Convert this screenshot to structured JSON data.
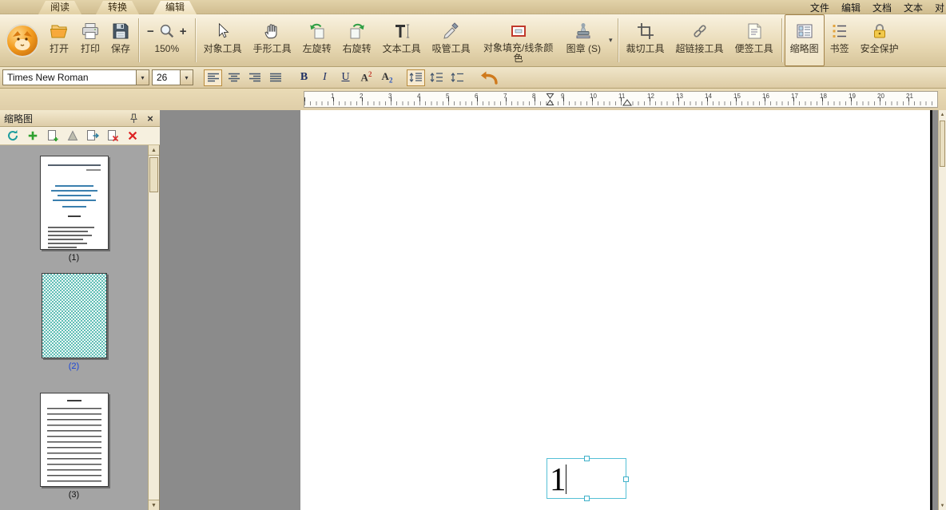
{
  "tabs": {
    "reading": "阅读",
    "convert": "转换",
    "edit": "编辑"
  },
  "top_menu": {
    "file": "文件",
    "edit": "编辑",
    "document": "文档",
    "text": "文本",
    "object": "对"
  },
  "toolbar": {
    "open": "打开",
    "print": "打印",
    "save": "保存",
    "zoom_out": "−",
    "zoom_in": "+",
    "zoom_level": "150%",
    "object_tool": "对象工具",
    "hand_tool": "手形工具",
    "rotate_left": "左旋转",
    "rotate_right": "右旋转",
    "text_tool": "文本工具",
    "eyedropper_tool": "吸管工具",
    "fill_line_color": "对象填充/线条颜色",
    "stamp": "图章 (S)",
    "crop_tool": "裁切工具",
    "hyperlink_tool": "超链接工具",
    "note_tool": "便签工具",
    "thumbnail": "缩略图",
    "bookmark": "书签",
    "security": "安全保护"
  },
  "format_bar": {
    "font_family": "Times New Roman",
    "font_size": "26",
    "bold": "B",
    "italic": "I",
    "underline": "U",
    "sup_base": "A",
    "sup_mark": "2",
    "sub_base": "A",
    "sub_mark": "2"
  },
  "ruler": {
    "numbers": [
      "1",
      "2",
      "3",
      "4",
      "5",
      "6",
      "7",
      "8",
      "9",
      "10",
      "11",
      "12",
      "13",
      "14",
      "15",
      "16",
      "17",
      "18",
      "19",
      "20",
      "21"
    ]
  },
  "thumbnail_panel": {
    "title": "缩略图",
    "pages": [
      {
        "label": "(1)",
        "selected": false
      },
      {
        "label": "(2)",
        "selected": true
      },
      {
        "label": "(3)",
        "selected": false
      }
    ]
  },
  "document": {
    "textbox_text": "1"
  },
  "glyphs": {
    "dropdown": "▾",
    "up": "▲",
    "down": "▼",
    "close": "×"
  },
  "icons": {
    "logo": "fox-logo",
    "open": "folder-open-icon",
    "print": "printer-icon",
    "save": "floppy-icon",
    "zoom": "magnifier-icon",
    "object_tool": "cursor-arrow-icon",
    "hand_tool": "hand-icon",
    "rotate_left": "rotate-ccw-icon",
    "rotate_right": "rotate-cw-icon",
    "text_tool": "text-t-icon",
    "eyedropper": "eyedropper-icon",
    "fill_line_color": "color-rect-icon",
    "stamp": "stamp-icon",
    "crop": "crop-icon",
    "hyperlink": "chain-link-icon",
    "note": "note-page-icon",
    "thumbnail": "thumbnail-panel-icon",
    "bookmark": "bookmark-list-icon",
    "security": "padlock-icon",
    "undo": "undo-arrow-icon",
    "pin": "pin-icon",
    "close": "close-icon"
  },
  "colors": {
    "chrome": "#e6d7b1",
    "chrome_dark": "#c9b78c",
    "accent": "#f39c1f",
    "selection": "#52bfd4",
    "checker": "#62c2ba",
    "doc_background": "#8b8b8b",
    "panel_background": "#a4a4a4"
  }
}
